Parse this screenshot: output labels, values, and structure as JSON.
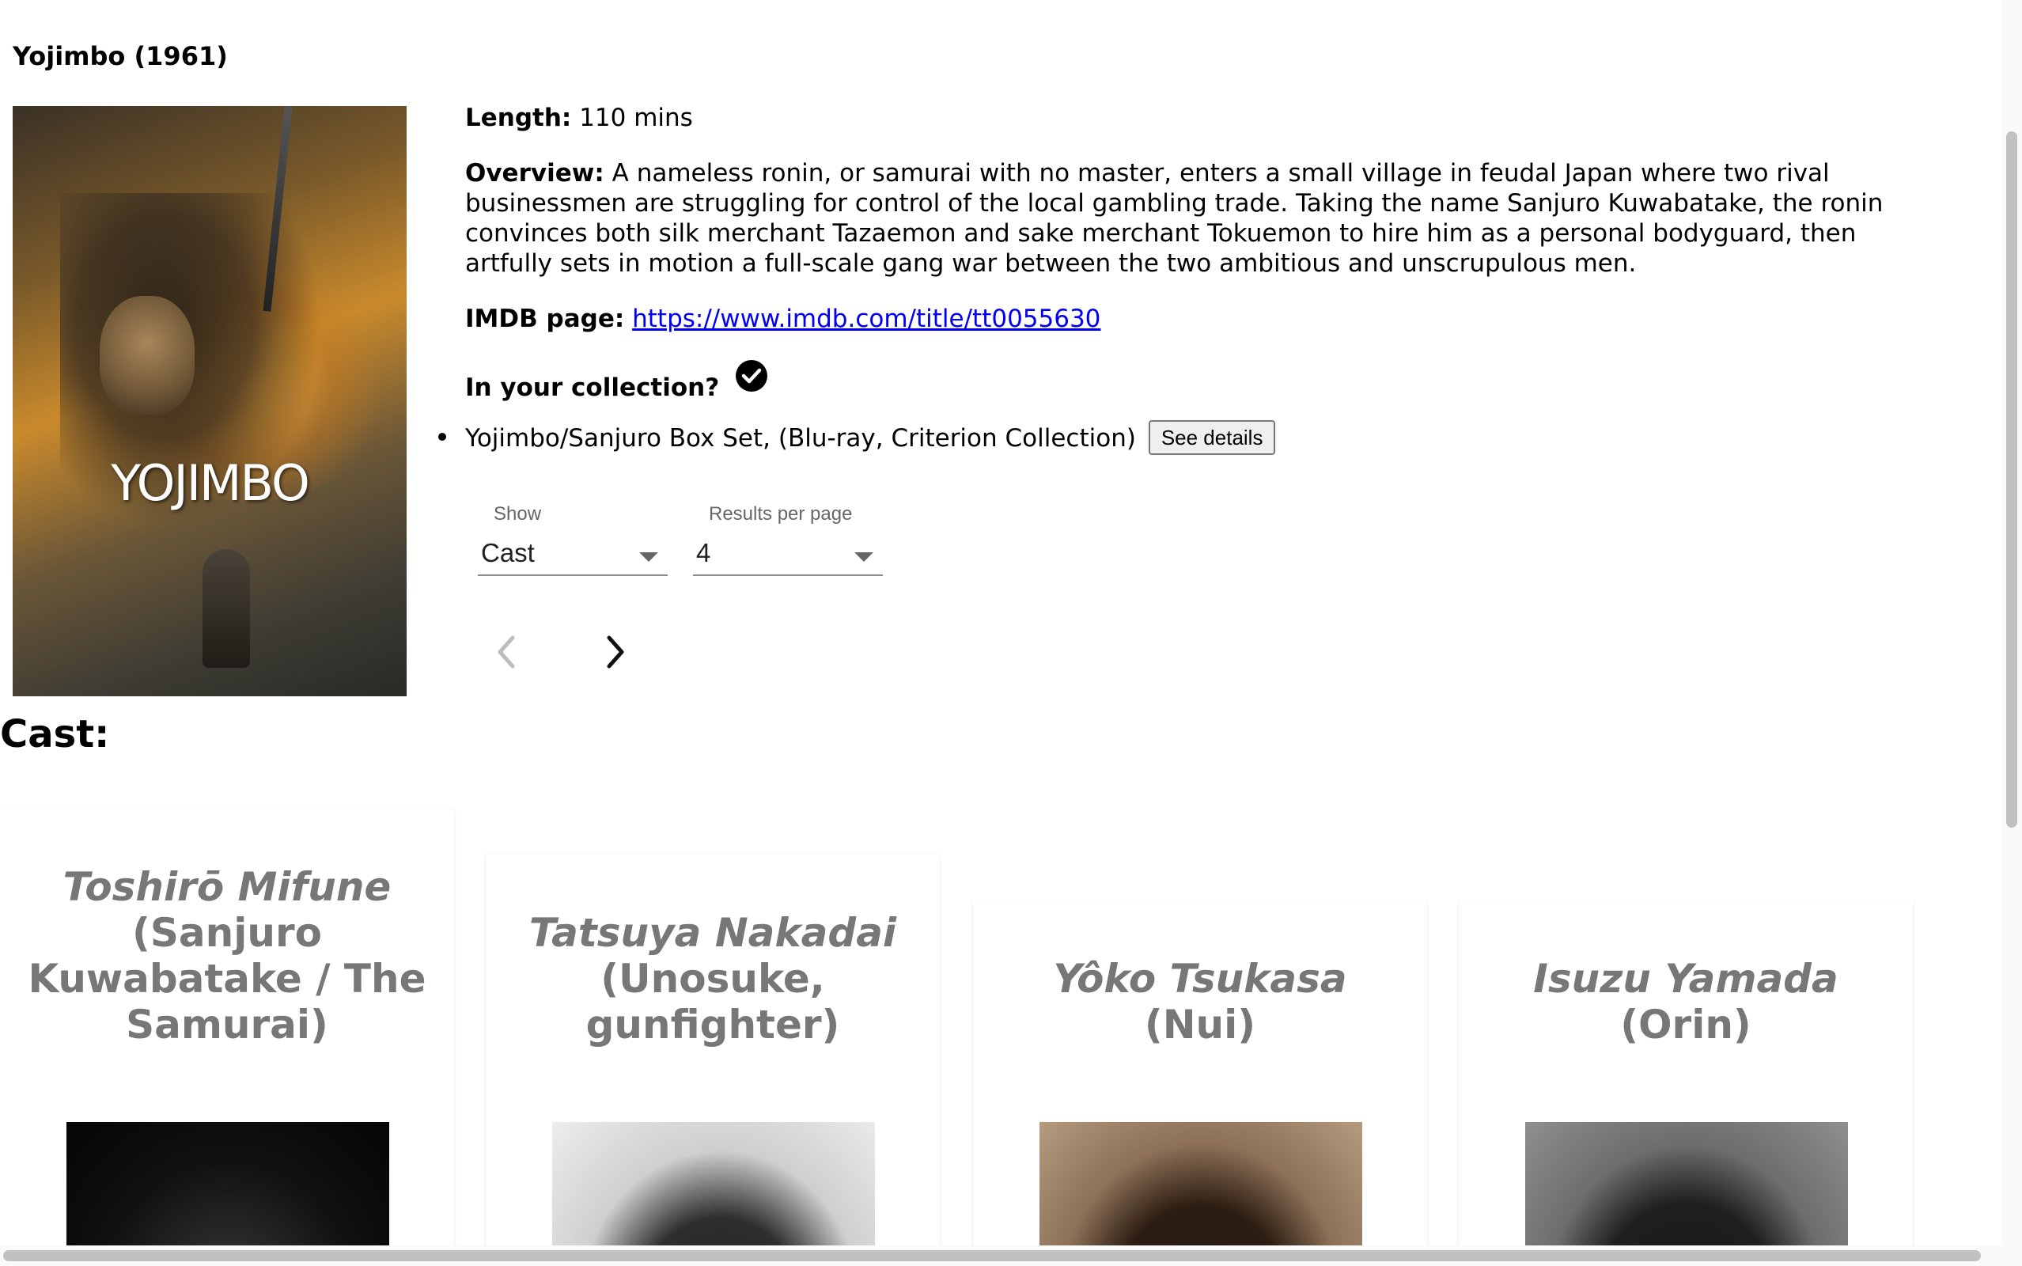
{
  "movie": {
    "title": "Yojimbo (1961)",
    "poster_title": "YOJIMBO",
    "length_label": "Length:",
    "length_value": "110 mins",
    "overview_label": "Overview:",
    "overview_text": "A nameless ronin, or samurai with no master, enters a small village in feudal Japan where two rival businessmen are struggling for control of the local gambling trade. Taking the name Sanjuro Kuwabatake, the ronin convinces both silk merchant Tazaemon and sake merchant Tokuemon to hire him as a personal bodyguard, then artfully sets in motion a full-scale gang war between the two ambitious and unscrupulous men.",
    "imdb_label": "IMDB page:",
    "imdb_url": "https://www.imdb.com/title/tt0055630",
    "collection_label": "In your collection?",
    "collection_items": [
      {
        "text": "Yojimbo/Sanjuro Box Set, (Blu-ray, Criterion Collection)",
        "button_label": "See details"
      }
    ]
  },
  "controls": {
    "show_label": "Show",
    "show_value": "Cast",
    "per_page_label": "Results per page",
    "per_page_value": "4"
  },
  "cast": {
    "heading": "Cast:",
    "members": [
      {
        "actor": "Toshirō Mifune",
        "role": "(Sanjuro Kuwabatake / The Samurai)"
      },
      {
        "actor": "Tatsuya Nakadai",
        "role": "(Unosuke, gunfighter)"
      },
      {
        "actor": "Yôko Tsukasa",
        "role": "(Nui)"
      },
      {
        "actor": "Isuzu Yamada",
        "role": "(Orin)"
      }
    ]
  },
  "icons": {
    "collection_status": "check-circle-icon",
    "prev": "chevron-left-icon",
    "next": "chevron-right-icon",
    "dropdown": "caret-down-icon"
  }
}
